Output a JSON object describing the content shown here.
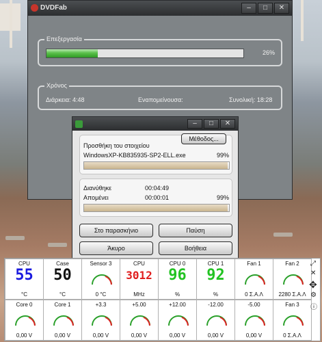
{
  "main_window": {
    "title": "DVDFab",
    "processing_label": "Επεξεργασία",
    "progress_percent": 26,
    "progress_text": "26%",
    "time_label": "Χρόνος",
    "duration_text": "Διάρκεια: 4:48",
    "remaining_text": "Εναπομείνουσα:",
    "total_text": "Συνολική: 18:28"
  },
  "dialog": {
    "method_button": "Μέθοδος...",
    "adding_label": "Προσθήκη του στοιχείου",
    "file_name": "WindowsXP-KB835935-SP2-ELL.exe",
    "file_percent_text": "99%",
    "file_progress": 99,
    "elapsed_label": "Διανύθηκε",
    "elapsed_value": "00:04:49",
    "remaining_label": "Απομένει",
    "remaining_value": "00:00:01",
    "total_percent_text": "99%",
    "total_progress": 99,
    "background_button": "Στο παρασκήνιο",
    "pause_button": "Παύση",
    "cancel_button": "Άκυρο",
    "help_button": "Βοήθεια"
  },
  "sensors": {
    "row1": [
      {
        "label": "CPU",
        "value": "55",
        "unit": "°C",
        "color": "#1a1adf",
        "type": "digit"
      },
      {
        "label": "Case",
        "value": "50",
        "unit": "°C",
        "color": "#111111",
        "type": "digit"
      },
      {
        "label": "Sensor 3",
        "value": "",
        "unit": "0 °C",
        "color": "#2aa02a",
        "type": "gauge"
      },
      {
        "label": "CPU",
        "value": "3012",
        "unit": "MHz",
        "color": "#e01e1e",
        "type": "digit"
      },
      {
        "label": "CPU 0",
        "value": "96",
        "unit": "%",
        "color": "#22c322",
        "type": "digit"
      },
      {
        "label": "CPU 1",
        "value": "92",
        "unit": "%",
        "color": "#22c322",
        "type": "digit"
      },
      {
        "label": "Fan 1",
        "value": "",
        "unit": "0 Σ.Α.Λ",
        "color": "#2aa02a",
        "type": "gauge"
      },
      {
        "label": "Fan 2",
        "value": "",
        "unit": "2280 Σ.Α.Λ",
        "color": "#2aa02a",
        "type": "gauge"
      }
    ],
    "row2": [
      {
        "label": "Core 0",
        "unit": "0,00 V"
      },
      {
        "label": "Core 1",
        "unit": "0,00 V"
      },
      {
        "label": "+3.3",
        "unit": "0,00 V"
      },
      {
        "label": "+5.00",
        "unit": "0,00 V"
      },
      {
        "label": "+12.00",
        "unit": "0,00 V"
      },
      {
        "label": "-12.00",
        "unit": "0,00 V"
      },
      {
        "label": "-5.00",
        "unit": "0,00 V"
      },
      {
        "label": "Fan 3",
        "unit": "0 Σ.Α.Λ"
      }
    ],
    "side_icons": [
      "pin-icon",
      "close-icon",
      "move-icon",
      "settings-icon",
      "info-icon"
    ]
  }
}
